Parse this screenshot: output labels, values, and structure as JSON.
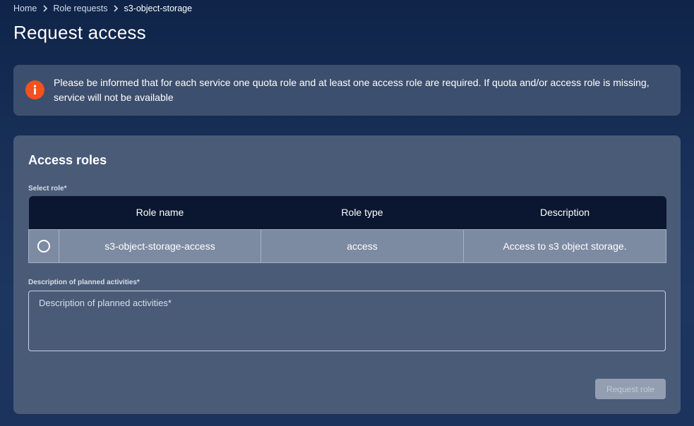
{
  "breadcrumb": {
    "items": [
      "Home",
      "Role requests",
      "s3-object-storage"
    ]
  },
  "page": {
    "title": "Request access"
  },
  "alert": {
    "icon": "info-icon",
    "color": "#f4511e",
    "text": "Please be informed that for each service one quota role and at least one access role are required. If quota and/or access role is missing, service will not be available"
  },
  "access_roles": {
    "title": "Access roles",
    "select_label": "Select role*",
    "columns": [
      "",
      "Role name",
      "Role type",
      "Description"
    ],
    "rows": [
      {
        "role_name": "s3-object-storage-access",
        "role_type": "access",
        "description": "Access to s3 object storage."
      }
    ],
    "description_label": "Description of planned activities*",
    "description_placeholder": "Description of planned activities*",
    "description_value": "",
    "submit_label": "Request role"
  }
}
